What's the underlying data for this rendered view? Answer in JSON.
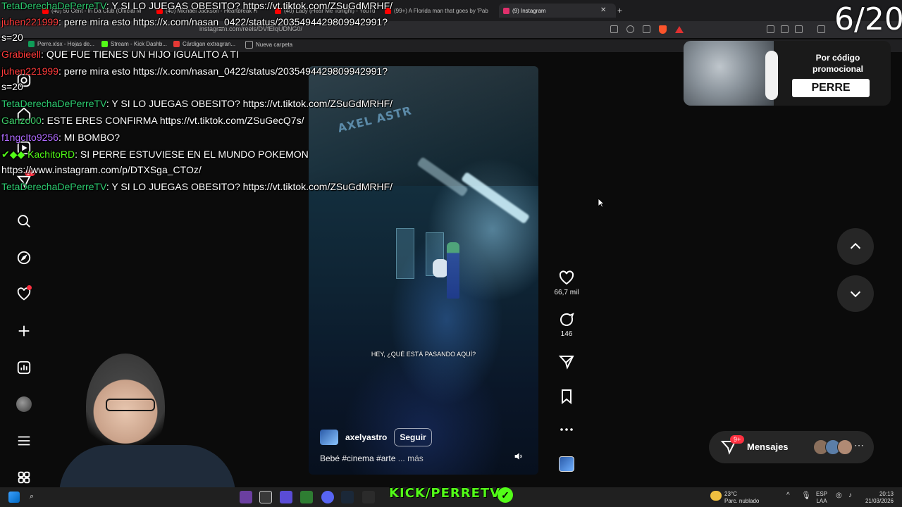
{
  "browser": {
    "tabs": [
      {
        "label": "(40) 50 Cent - In Da Club (Official M",
        "color": "#ff0000"
      },
      {
        "label": "(40) Michael Jackson - Heartbreak H",
        "color": "#ff0000"
      },
      {
        "label": "(40) Lady (Hear Me Tonight) - YouTu",
        "color": "#ff0000"
      },
      {
        "label": "(99+) A Florida man that goes by 'Pab",
        "color": "#ff0000"
      },
      {
        "label": "(9) Instagram",
        "color": "#e1306c"
      }
    ],
    "url": "instagram.com/reels/DVfEIqUDNG0/",
    "bookmarks": [
      {
        "label": "Perre.xlsx - Hojas de...",
        "color": "#0f9d58"
      },
      {
        "label": "Stream - Kick Dashb...",
        "color": "#53fc18"
      },
      {
        "label": "Cárdigan extragran...",
        "color": "#e53935"
      },
      {
        "label": "Nueva carpeta",
        "color": "#9e9e9e"
      }
    ]
  },
  "chat": [
    {
      "user": "TetaDerechaDePerreTV",
      "user_color": "#2ecc71",
      "text": "Y SI LO JUEGAS OBESITO? https://vt.tiktok.com/ZSuGdMRHF/"
    },
    {
      "user": "juhen221999",
      "user_color": "#ff3b3b",
      "text": "perre mira esto https://x.com/nasan_0422/status/2035494429809942991?"
    },
    {
      "user": "",
      "user_color": "#ffffff",
      "text": "s=20"
    },
    {
      "user": "Grabieell",
      "user_color": "#ff3b3b",
      "text": "QUE FUE TIENES UN HIJO IGUALITO A TI"
    },
    {
      "user": "juhen221999",
      "user_color": "#ff3b3b",
      "text": "perre mira esto https://x.com/nasan_0422/status/2035494429809942991?"
    },
    {
      "user": "",
      "user_color": "#ffffff",
      "text": "s=20"
    },
    {
      "user": "TetaDerechaDePerreTV",
      "user_color": "#2ecc71",
      "text": "Y SI LO JUEGAS OBESITO? https://vt.tiktok.com/ZSuGdMRHF/"
    },
    {
      "user": "Ganzo00",
      "user_color": "#3fd06b",
      "text": "ESTE ERES CONFIRMA https://vt.tiktok.com/ZSuGecQ7s/"
    },
    {
      "user": "f1ngcIto9256",
      "user_color": "#b06bff",
      "text": "MI BOMBO?"
    },
    {
      "user": "KachitoRD",
      "user_color": "#53fc18",
      "text": "SI PERRE ESTUVIESE EN EL MUNDO POKEMON"
    },
    {
      "user": "",
      "user_color": "#ffffff",
      "text": "https://www.instagram.com/p/DTXSga_CTOz/"
    },
    {
      "user": "TetaDerechaDePerreTV",
      "user_color": "#2ecc71",
      "text": "Y SI LO JUEGAS OBESITO? https://vt.tiktok.com/ZSuGdMRHF/"
    }
  ],
  "counter": "6/20",
  "promo": {
    "text": "Por código promocional",
    "code": "PERRE"
  },
  "sidebar": {
    "notifications_badge": "9+",
    "icons": [
      "search-icon",
      "explore-icon",
      "heart-icon",
      "create-icon",
      "dashboard-icon",
      "profile-avatar",
      "menu-icon",
      "apps-icon"
    ]
  },
  "reel": {
    "subtitle": "HEY, ¿QUÉ ESTÁ PASANDO AQUÍ?",
    "logo_text": "AXEL ASTR",
    "author": "axelyastro",
    "follow_label": "Seguir",
    "caption": "Bebé #cinema #arte",
    "caption_more": "... más",
    "likes": "66,7 mil",
    "comments": "146"
  },
  "messages": {
    "label": "Mensajes",
    "badge": "9+"
  },
  "stream": {
    "kick_brand": "KICK/PERRETV"
  },
  "tray": {
    "temperature": "23°C",
    "weather": "Parc. nublado",
    "lang_top": "ESP",
    "lang_bottom": "LAA",
    "time": "20:13",
    "date": "21/03/2026"
  },
  "colors": {
    "instagram_dark": "#0b0b0b",
    "kick_green": "#53fc18",
    "notification_red": "#ff3040"
  }
}
